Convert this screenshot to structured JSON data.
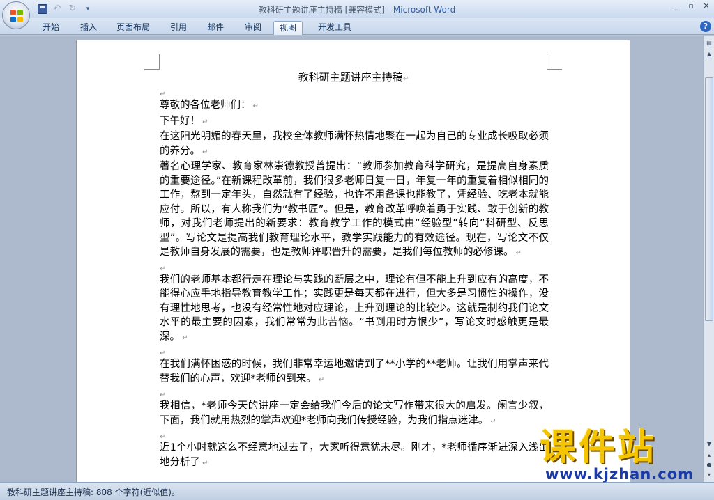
{
  "window": {
    "title_doc": "教科研主题讲座主持稿 [兼容模式] - ",
    "title_app": "Microsoft Word",
    "minimize": "_",
    "restore": "▫",
    "close": "✕"
  },
  "qat": {
    "undo_icon": "↶",
    "redo_icon": "↻",
    "customize_icon": "▾"
  },
  "ribbon": {
    "tabs": [
      "开始",
      "插入",
      "页面布局",
      "引用",
      "邮件",
      "审阅",
      "视图",
      "开发工具"
    ],
    "active_tab": "视图",
    "help": "?"
  },
  "document": {
    "title": "教科研主题讲座主持稿",
    "paragraphs": [
      "",
      "尊敬的各位老师们：",
      "下午好！",
      "在这阳光明媚的春天里，我校全体教师满怀热情地聚在一起为自己的专业成长吸取必须的养分。",
      "著名心理学家、教育家林崇德教授曾提出：“教师参加教育科学研究，是提高自身素质的重要途径。”在新课程改革前，我们很多老师日复一日，年复一年的重复着相似相同的工作，熬到一定年头，自然就有了经验，也许不用备课也能教了，凭经验、吃老本就能应付。所以，有人称我们为“教书匠”。但是，教育改革呼唤着勇于实践、敢于创新的教师，对我们老师提出的新要求：教育教学工作的模式由“经验型”转向“科研型、反思型”。写论文是提高我们教育理论水平，教学实践能力的有效途径。现在，写论文不仅是教师自身发展的需要，也是教师评职晋升的需要，是我们每位教师的必修课。",
      "",
      "我们的老师基本都行走在理论与实践的断层之中，理论有但不能上升到应有的高度，不能得心应手地指导教育教学工作；实践更是每天都在进行，但大多是习惯性的操作，没有理性地思考，也没有经常性地对应理论，上升到理论的比较少。这就是制约我们论文水平的最主要的因素，我们常常为此苦恼。“书到用时方恨少”，写论文时感触更是最深。",
      "",
      "在我们满怀困惑的时候，我们非常幸运地邀请到了**小学的**老师。让我们用掌声来代替我们的心声，欢迎*老师的到来。",
      "",
      "我相信，*老师今天的讲座一定会给我们今后的论文写作带来很大的启发。闲言少叙，下面，我们就用热烈的掌声欢迎*老师向我们传授经验，为我们指点迷津。",
      "",
      "近1个小时就这么不经意地过去了，大家听得意犹未尽。刚才，*老师循序渐进深入浅出地分析了"
    ]
  },
  "watermark": {
    "text": "课件站",
    "url": "www.kjzhan.com"
  },
  "status": {
    "text": "教科研主题讲座主持稿: 808 个字符(近似值)。"
  },
  "scrollbar": {
    "up": "▲",
    "down": "▼",
    "prev_page": "▴",
    "next_page": "▾",
    "select": "●"
  }
}
